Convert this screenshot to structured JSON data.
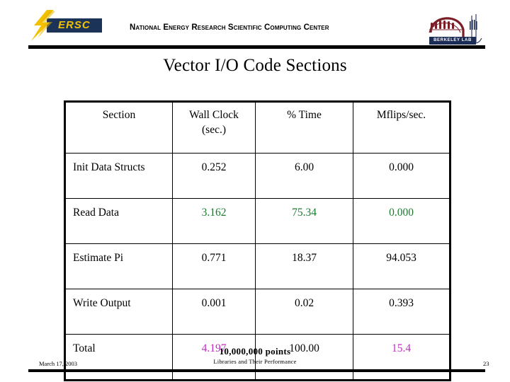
{
  "header": {
    "org_name": "National Energy Research Scientific Computing Center",
    "nersc_logo_text": "ERSC",
    "nersc_logo_icon": "lightning-bolt-icon",
    "berkeley_logo_text": "BERKELEY LAB",
    "berkeley_logo_icon": "berkeley-dome-icon"
  },
  "slide": {
    "title": "Vector I/O Code Sections"
  },
  "colors": {
    "accent_green": "#1a7a2e",
    "accent_magenta": "#c32bc3",
    "text_black": "#000000",
    "nersc_navy": "#1b3357",
    "nersc_yellow": "#f2c200",
    "berkeley_navy": "#1b2c57",
    "berkeley_dark_red": "#7a1f28"
  },
  "chart_data": {
    "type": "table",
    "title": "Vector I/O Code Sections",
    "columns": [
      "Section",
      "Wall Clock (sec.)",
      "% Time",
      "Mflips/sec."
    ],
    "column_headers_display": [
      {
        "line1": "Section",
        "line2": ""
      },
      {
        "line1": "Wall Clock",
        "line2": "(sec.)"
      },
      {
        "line1": "% Time",
        "line2": ""
      },
      {
        "line1": "Mflips/sec.",
        "line2": ""
      }
    ],
    "rows": [
      {
        "section": "Init Data Structs",
        "wall_clock": "0.252",
        "percent_time": "6.00",
        "mflips": "0.000",
        "value_color": "#000000"
      },
      {
        "section": "Read Data",
        "wall_clock": "3.162",
        "percent_time": "75.34",
        "mflips": "0.000",
        "value_color": "#1a7a2e"
      },
      {
        "section": "Estimate Pi",
        "wall_clock": "0.771",
        "percent_time": "18.37",
        "mflips": "94.053",
        "value_color": "#000000"
      },
      {
        "section": "Write Output",
        "wall_clock": "0.001",
        "percent_time": "0.02",
        "mflips": "0.393",
        "value_color": "#000000"
      },
      {
        "section": "Total",
        "wall_clock": "4.197",
        "percent_time": "100.00",
        "mflips": "15.4",
        "value_color": "#c32bc3",
        "percent_time_color": "#000000"
      }
    ],
    "notes": "Wall Clock and Mflips/sec. for 'Read Data' shown in green; 'Total' row Wall Clock and Mflips/sec. shown in magenta."
  },
  "footer": {
    "main_note": "10,000,000 points",
    "sub_note": "Libraries and Their Performance",
    "date": "March 17, 2003",
    "page_number": "23"
  }
}
